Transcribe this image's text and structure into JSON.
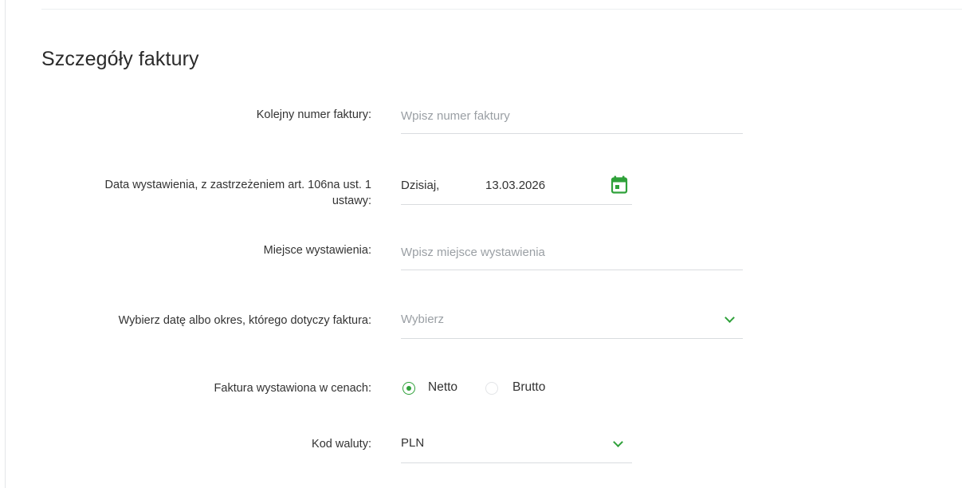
{
  "section": {
    "title": "Szczegóły faktury"
  },
  "fields": {
    "invoice_number": {
      "label": "Kolejny numer faktury:",
      "placeholder": "Wpisz numer faktury"
    },
    "issue_date": {
      "label_line1": "Data wystawienia, z zastrzeżeniem art. 106na ust. 1",
      "label_line2": "ustawy:",
      "prefix": "Dzisiaj,",
      "value": "13.03.2026",
      "icon": "calendar-icon"
    },
    "issue_place": {
      "label": "Miejsce wystawienia:",
      "placeholder": "Wpisz miejsce wystawienia"
    },
    "period": {
      "label": "Wybierz datę albo okres, którego dotyczy faktura:",
      "placeholder": "Wybierz",
      "icon": "chevron-down-icon"
    },
    "price_type": {
      "label": "Faktura wystawiona w cenach:",
      "options": [
        "Netto",
        "Brutto"
      ],
      "selected": "Netto"
    },
    "currency": {
      "label": "Kod waluty:",
      "value": "PLN",
      "icon": "chevron-down-icon"
    }
  },
  "colors": {
    "accent": "#2fa13a",
    "text": "#333333",
    "placeholder": "#9a9fa4",
    "underline": "#d9dcdf"
  }
}
